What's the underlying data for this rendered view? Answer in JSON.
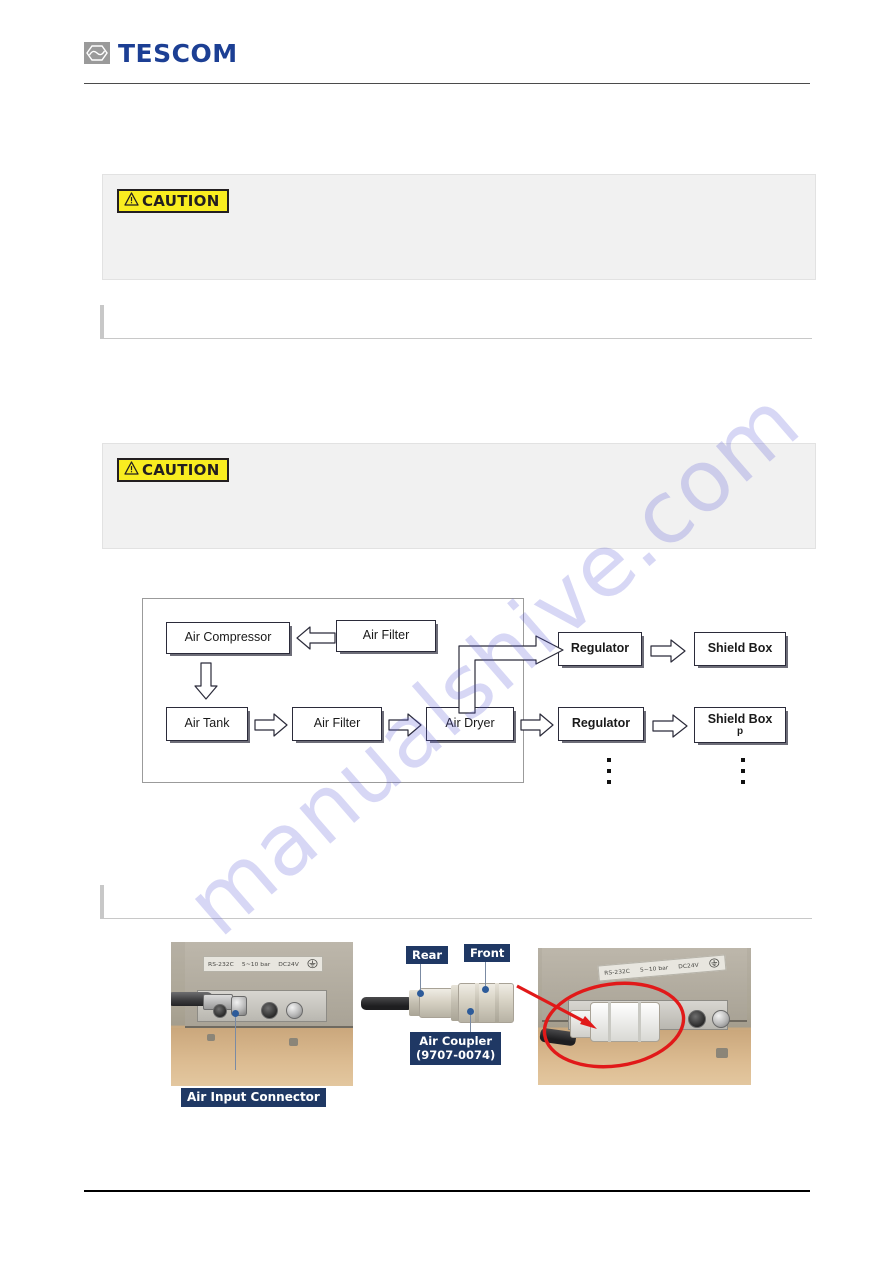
{
  "header": {
    "logo_text": "TESCOM",
    "logo_icon": "hexagon-wave-logo-icon"
  },
  "caution_blocks": [
    {
      "badge_label": "CAUTION",
      "badge_icon": "warning-triangle-icon",
      "body_text": ""
    },
    {
      "badge_label": "CAUTION",
      "badge_icon": "warning-triangle-icon",
      "body_text": ""
    }
  ],
  "section_bars": [
    {
      "title": ""
    },
    {
      "title": ""
    }
  ],
  "flow_diagram": {
    "nodes": {
      "air_compressor": "Air Compressor",
      "air_filter_1": "Air Filter",
      "air_tank": "Air Tank",
      "air_filter_2": "Air Filter",
      "air_dryer": "Air Dryer",
      "regulator_1": "Regulator",
      "regulator_2": "Regulator",
      "shield_box_1": "Shield Box",
      "shield_box_2": "Shield Box",
      "shield_box_2_sub": "p"
    },
    "continuation_icon": "vertical-ellipsis-icon"
  },
  "photos": {
    "left": {
      "callout": "Air Input Connector",
      "plate_text": [
        "RS-232C",
        "5~10 bar",
        "DC24V"
      ],
      "ground_icon": "earth-ground-icon"
    },
    "middle": {
      "callout_rear": "Rear",
      "callout_front": "Front",
      "callout_coupler_line1": "Air Coupler",
      "callout_coupler_line2": "(9707-0074)"
    },
    "right": {
      "plate_text": [
        "RS-232C",
        "5~10 bar",
        "DC24V"
      ],
      "highlight_icon": "red-ellipse-highlight-icon",
      "pointer_icon": "red-arrow-icon"
    }
  },
  "watermark": {
    "text": "manualshive.com"
  },
  "colors": {
    "brand_blue": "#1c3f94",
    "caution_yellow": "#f9ed20",
    "callout_navy": "#1f3864",
    "panel_gray": "#f1f1f1",
    "highlight_red": "#e11919"
  }
}
